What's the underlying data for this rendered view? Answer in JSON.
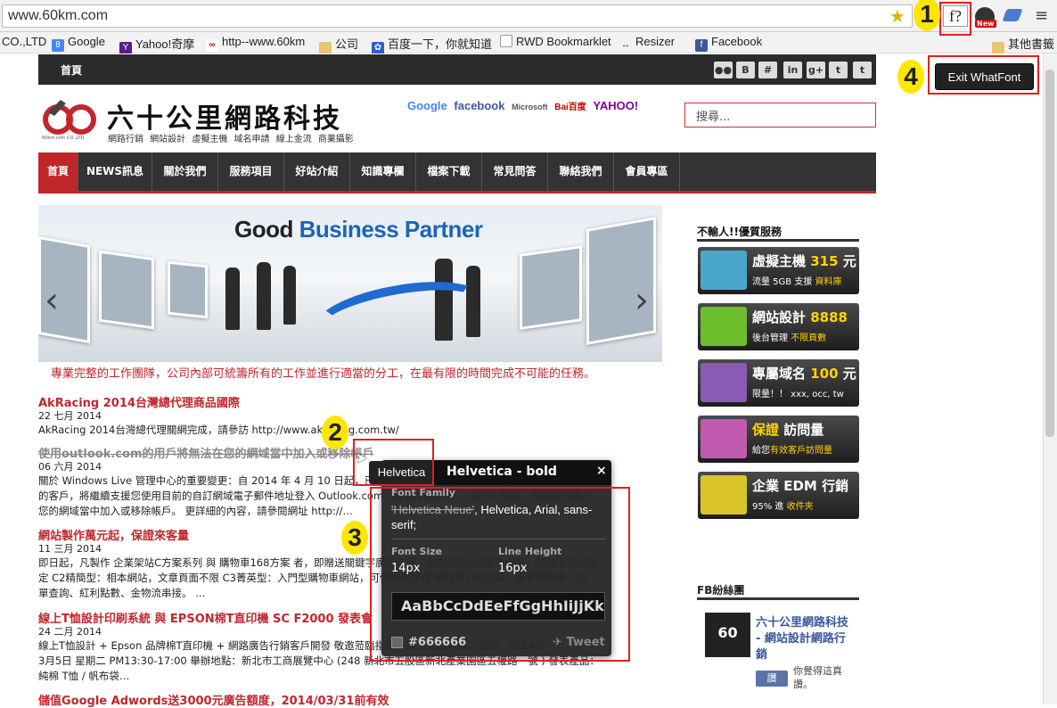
{
  "browser": {
    "url": "www.60km.com",
    "bookmarks": [
      {
        "label": "CO.,LTD",
        "icon": "none"
      },
      {
        "label": "Google",
        "icon": "google-icon"
      },
      {
        "label": "Yahoo!奇摩",
        "icon": "yahoo-icon"
      },
      {
        "label": "http--www.60km",
        "icon": "60km-icon"
      },
      {
        "label": "公司",
        "icon": "folder-icon"
      },
      {
        "label": "百度一下，你就知道",
        "icon": "baidu-icon"
      },
      {
        "label": "RWD Bookmarklet",
        "icon": "page-icon"
      },
      {
        "label": "Resizer",
        "icon": "resize-icon"
      },
      {
        "label": "Facebook",
        "icon": "facebook-icon"
      }
    ],
    "other_bookmarks": "其他書籤",
    "whatfont_ext": "f?",
    "new_badge": "New"
  },
  "site": {
    "top_home": "首頁",
    "social": [
      "f",
      "B",
      "#",
      "in",
      "g+",
      "t"
    ],
    "logo_text": "60",
    "logo_sub": "60km.com CO.,LTD.",
    "brand": "六十公里網路科技",
    "brand_sub": "網路行銷 網站設計 虛擬主機 域名申請 線上金流 商業攝影",
    "partners": [
      "Google",
      "facebook",
      "Microsoft",
      "Bai百度",
      "YAHOO!"
    ],
    "search_placeholder": "搜尋...",
    "nav": [
      "首頁",
      "NEWS訊息",
      "關於我們",
      "服務項目",
      "好站介紹",
      "知識專欄",
      "檔案下載",
      "常見問答",
      "聯絡我們",
      "會員專區"
    ],
    "banner_title_a": "Good ",
    "banner_title_b": "Business",
    "banner_title_c": " Partner",
    "tagline": "專業完整的工作團隊，公司內部可統籌所有的工作並進行適當的分工，在最有限的時間完成不可能的任務。",
    "news": [
      {
        "title": "AkRacing 2014台灣總代理商品國際",
        "date": "22 七月 2014",
        "body": [
          "AkRacing 2014台灣總代理關網完成，請參訪 http://www.akracing.com.tw/"
        ]
      },
      {
        "title": "使用outlook.com的用戶將無法在您的網域當中加入或移除帳戶",
        "date": "06 六月 2014",
        "body": [
          "關於 Windows Live 管理中心的重要變更：自 2014 年 4 月 10 日起，已停用自訂網域註冊，對於目前",
          "的客戶，將繼續支援您使用目前的自訂網域電子郵件地址登入 Outlook.com，直到 2014 年 7 月 31 日起，您將無法再於",
          "您的網域當中加入或移除帳戶。 更詳細的內容，請參閱網址 http://..."
        ]
      },
      {
        "title": "網站製作萬元起，保證來客量",
        "date": "11 三月 2014",
        "body": [
          "即日起，凡製作 企業架站C方案系列 與 購物車168方案 者，即贈送關鍵字廣告方案 C1精簡型公司形象網站，關鍵字SEO設",
          "定 C2精簡型：相本網站，文章頁面不限 C3菁英型：入門型購物車網站，可供後台管理 購物車168方案：專業購物車，訂",
          "單查詢、紅利點數、金物流串接。 …"
        ]
      },
      {
        "title": "線上T恤設計印刷系統 與 EPSON棉T直印機 SC F2000 發表會",
        "date": "24 二月 2014",
        "body": [
          "線上T恤設計 + Epson 品牌棉T直印機 + 網路廣告行銷客戶開發   敬邀蒞臨指導，請您蒞臨指導。日期：2014年",
          "3月5日 星期二 PM13:30-17:00 舉辦地點：新北市工商展覽中心 (248 新北市五股區新北產業園區五權路一號 ) 發表產品：",
          "純棉 T恤 / 帆布袋…"
        ]
      },
      {
        "title": "儲值Google Adwords送3000元廣告額度，2014/03/31前有效",
        "date": "",
        "body": []
      }
    ],
    "sidebar_title": "不輸人!!優質服務",
    "services": [
      {
        "t1a": "虛擬主機 ",
        "t1b": "315",
        "t1c": " 元",
        "t2a": "流量 5GB 支援 ",
        "t2b": "資料庫",
        "icon": "cpu-icon",
        "color": "#4aa7c9"
      },
      {
        "t1a": "網站設計 ",
        "t1b": "8888",
        "t1c": "",
        "t2a": "後台管理 ",
        "t2b": "不限頁數",
        "icon": "ie-icon",
        "color": "#6cbf2a"
      },
      {
        "t1a": "專屬域名 ",
        "t1b": "100",
        "t1c": " 元",
        "t2a": "限量！！ xxx, occ, tw",
        "t2b": "",
        "icon": "globe-hand-icon",
        "color": "#8a5bb5"
      },
      {
        "t1a": "",
        "t1b": "保證",
        "t1c": " 訪問量",
        "t2a": "給您",
        "t2b": "有效客戶訪問量",
        "icon": "chart-icon",
        "color": "#c05bb0"
      },
      {
        "t1a": "企業 EDM 行銷",
        "t1b": "",
        "t1c": "",
        "t2a": "95% 進 ",
        "t2b": "收件夾",
        "icon": "mail-icon",
        "color": "#d9c52a"
      }
    ],
    "fb_title": "FB紛絲團",
    "fb_logo": "60",
    "fb_name": "六十公里網路科技 - 網站設計網路行銷",
    "fb_like": "讚",
    "fb_likes_text": "你覺得這真讚。"
  },
  "whatfont": {
    "exit_label": "Exit WhatFont",
    "tip_font": "Helvetica",
    "panel_title": "Helvetica - bold",
    "close": "×",
    "family_label": "Font Family",
    "family_struck": "'Helvetica Neue'",
    "family_rest": ", Helvetica, Arial, sans-serif;",
    "size_label": "Font Size",
    "size_value": "14px",
    "lh_label": "Line Height",
    "lh_value": "16px",
    "sample": "AaBbCcDdEeFfGgHhIiJjKk",
    "color_hex": "#666666",
    "tweet": "Tweet"
  },
  "annotations": [
    "1",
    "2",
    "3",
    "4"
  ]
}
